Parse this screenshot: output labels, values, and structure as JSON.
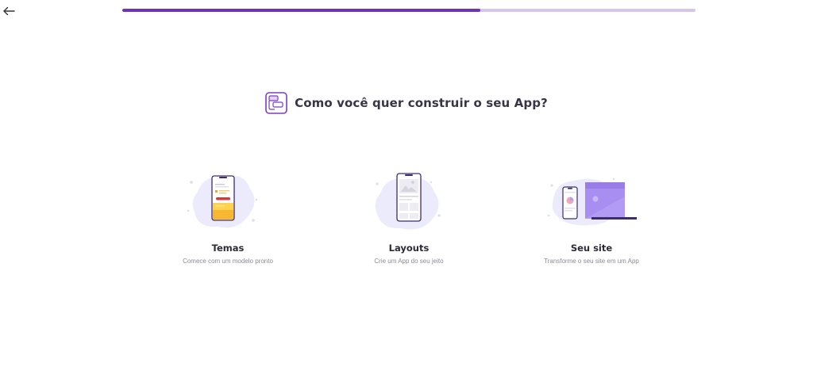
{
  "progress": {
    "value": 0.625
  },
  "header": {
    "title": "Como você quer construir o seu App?",
    "icon": "app-builder-icon"
  },
  "options": [
    {
      "label": "Temas",
      "description": "Comece com um modelo pronto",
      "icon": "themes-illustration"
    },
    {
      "label": "Layouts",
      "description": "Crie um App do seu jeito",
      "icon": "layouts-illustration"
    },
    {
      "label": "Seu site",
      "description": "Transforme o seu site em um App",
      "icon": "website-illustration"
    }
  ],
  "colors": {
    "accent": "#6d33b8",
    "accent_light": "#d6c6ec",
    "blob": "#ecebfb",
    "title": "#3a3545",
    "muted": "#8a8a94"
  }
}
